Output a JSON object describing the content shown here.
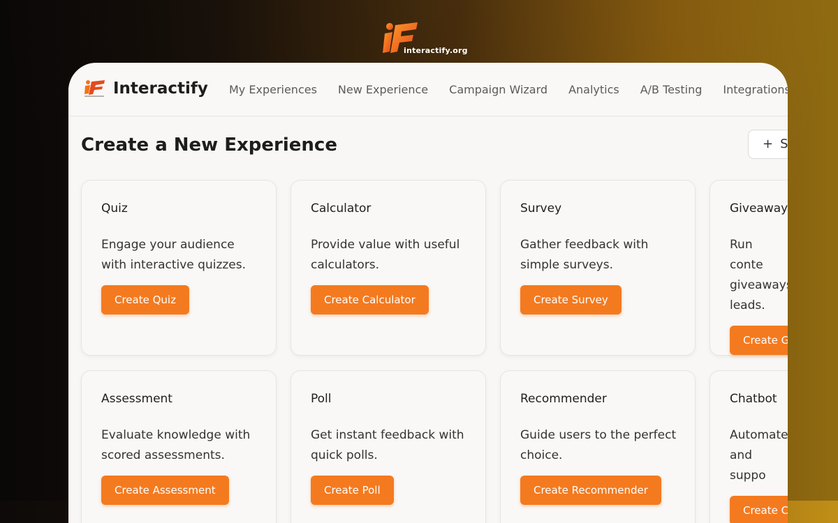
{
  "brand": {
    "url_label": "interactify.org"
  },
  "app": {
    "name": "Interactify",
    "nav": [
      "My Experiences",
      "New Experience",
      "Campaign Wizard",
      "Analytics",
      "A/B Testing",
      "Integrations"
    ]
  },
  "page": {
    "title": "Create a New Experience",
    "new_button_label": "S",
    "new_button_icon": "plus-icon"
  },
  "cards": [
    {
      "title": "Quiz",
      "description": "Engage your audience with interactive quizzes.",
      "button": "Create Quiz"
    },
    {
      "title": "Calculator",
      "description": "Provide value with useful calculators.",
      "button": "Create Calculator"
    },
    {
      "title": "Survey",
      "description": "Gather feedback with simple surveys.",
      "button": "Create Survey"
    },
    {
      "title": "Giveaway",
      "description": "Run conte giveaways leads.",
      "button": "Create G"
    },
    {
      "title": "Assessment",
      "description": "Evaluate knowledge with scored assessments.",
      "button": "Create Assessment"
    },
    {
      "title": "Poll",
      "description": "Get instant feedback with quick polls.",
      "button": "Create Poll"
    },
    {
      "title": "Recommender",
      "description": "Guide users to the perfect choice.",
      "button": "Create Recommender"
    },
    {
      "title": "Chatbot",
      "description": "Automate and suppo",
      "button": "Create C"
    }
  ],
  "colors": {
    "accent": "#f47a1f",
    "window_bg": "#f8f7f5",
    "text": "#1d1d1d"
  }
}
